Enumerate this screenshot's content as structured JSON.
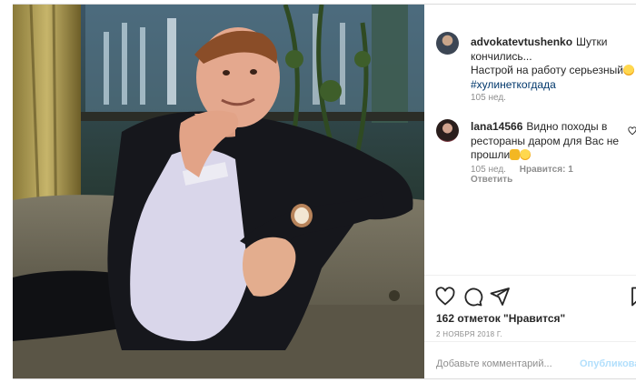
{
  "post": {
    "owner_username": "advokatevtushenko",
    "caption_text": "Шутки кончились... Настрой на работу серьезный",
    "caption_line1": "Шутки",
    "caption_line2": "кончились...",
    "caption_line3": "Настрой на работу серьезный",
    "hashtag": "#хулинеткогдада",
    "age": "105 нед."
  },
  "comment": {
    "username": "lana14566",
    "text_line1": "Видно походы в",
    "text_line2": "рестораны даром для Вас не",
    "text_line3": "прошли",
    "age": "105 нед.",
    "likes_label": "Нравится: 1",
    "reply_label": "Ответить"
  },
  "actions": {
    "icons": [
      "heart-icon",
      "comment-icon",
      "share-icon",
      "bookmark-icon"
    ],
    "likes_text": "162 отметок \"Нравится\"",
    "date": "2 ноября 2018 г."
  },
  "input": {
    "placeholder": "Добавьте комментарий...",
    "submit_label": "Опубликовать"
  },
  "colors": {
    "text": "#262626",
    "muted": "#8e8e8e",
    "hashtag": "#00376b",
    "publish_disabled": "#b2dffc",
    "border": "#dbdbdb"
  }
}
